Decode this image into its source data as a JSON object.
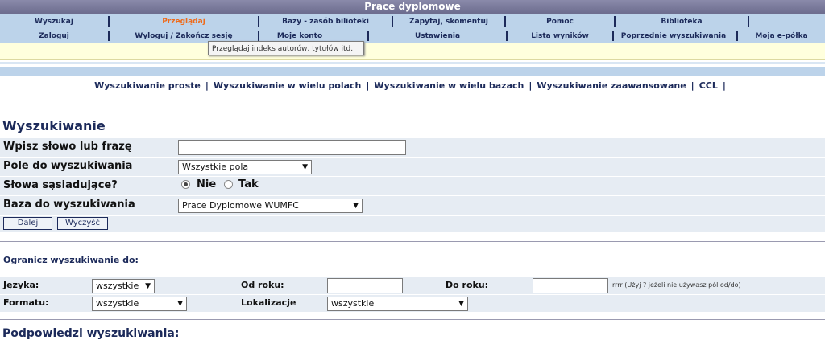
{
  "app": {
    "title": "Prace dyplomowe"
  },
  "nav_top": {
    "items": [
      "Wyszukaj",
      "Przeglądaj",
      "Bazy - zasób bilioteki",
      "Zapytaj, skomentuj",
      "Pomoc",
      "Biblioteka"
    ]
  },
  "nav_second": {
    "items": [
      "Zaloguj",
      "Wyloguj / Zakończ sesję",
      "Moje konto",
      "Ustawienia",
      "Lista wyników",
      "Poprzednie wyszukiwania",
      "Moja e-półka"
    ]
  },
  "tooltip": {
    "text": "Przeglądaj indeks autorów, tytułów itd."
  },
  "subnav": {
    "items": [
      "Wyszukiwanie proste",
      "Wyszukiwanie w wielu polach",
      "Wyszukiwanie w wielu bazach",
      "Wyszukiwanie zaawansowane",
      "CCL"
    ],
    "separator": "|"
  },
  "search": {
    "heading": "Wyszukiwanie",
    "phrase_label": "Wpisz słowo lub frazę",
    "phrase_value": "",
    "field_label": "Pole do wyszukiwania",
    "field_value": "Wszystkie pola",
    "adjacent_label": "Słowa sąsiadujące?",
    "adjacent_no": "Nie",
    "adjacent_yes": "Tak",
    "adjacent_selected": "Nie",
    "base_label": "Baza do wyszukiwania",
    "base_value": "Prace Dyplomowe WUMFC",
    "next_button": "Dalej",
    "clear_button": "Wyczyść"
  },
  "limits": {
    "title": "Ogranicz wyszukiwanie do:",
    "language_label": "Języka:",
    "language_value": "wszystkie",
    "from_year_label": "Od roku:",
    "from_year_value": "",
    "to_year_label": "Do roku:",
    "to_year_value": "",
    "year_hint": "rrrr (Użyj ? jeżeli nie używasz pól od/do)",
    "format_label": "Formatu:",
    "format_value": "wszystkie",
    "location_label": "Lokalizacje",
    "location_value": "wszystkie"
  },
  "hints": {
    "title": "Podpowiedzi wyszukiwania:"
  },
  "colors": {
    "nav_bg": "#bcd3ea",
    "nav_text": "#1c2a5a",
    "active": "#ee6a1a",
    "title_bar": "#7a7a9c",
    "row_bg": "#e6ecf3"
  }
}
